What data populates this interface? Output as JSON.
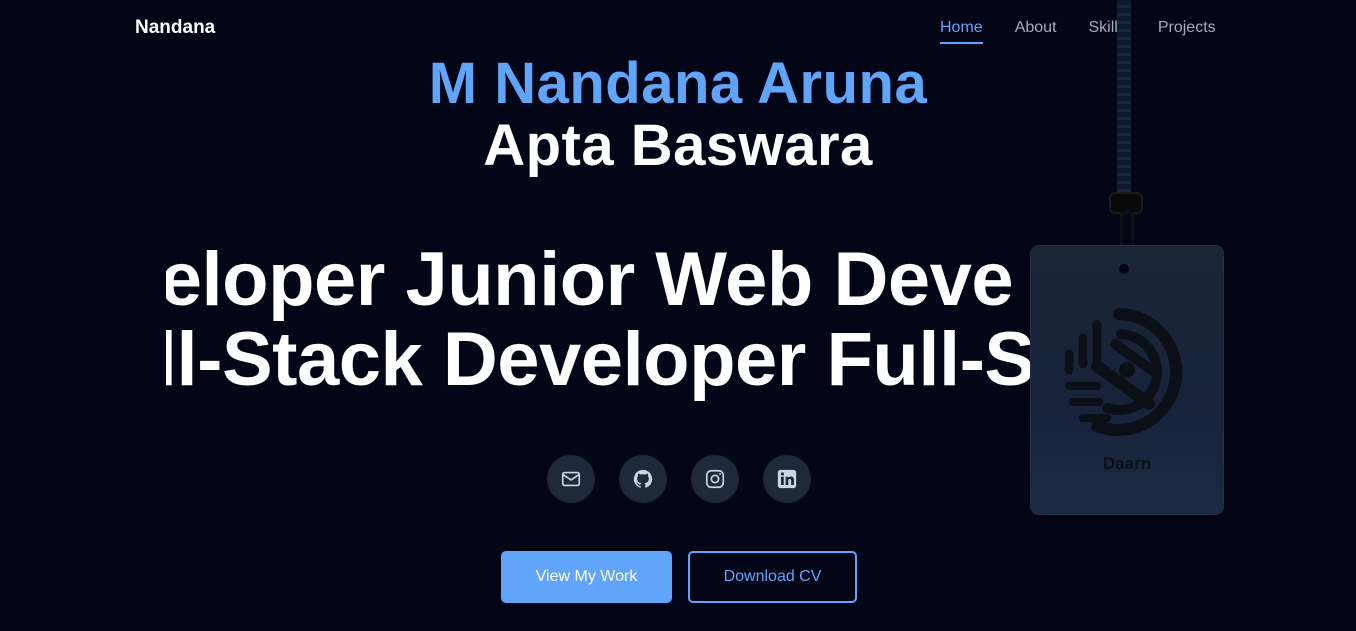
{
  "nav": {
    "brand": "Nandana",
    "items": [
      "Home",
      "About",
      "Skills",
      "Projects"
    ],
    "active": "Home"
  },
  "hero": {
    "name_first": "M Nandana Aruna",
    "name_last": "Apta Baswara",
    "marquee_row1": "veloper Junior Web Deve",
    "marquee_row2": "ull-Stack Developer Full-S"
  },
  "socials": [
    {
      "icon": "mail-icon"
    },
    {
      "icon": "github-icon"
    },
    {
      "icon": "instagram-icon"
    },
    {
      "icon": "linkedin-icon"
    }
  ],
  "buttons": {
    "primary": "View My Work",
    "secondary": "Download CV"
  },
  "badge": {
    "label": "Daarn",
    "icon": "monogram-logo"
  },
  "colors": {
    "background": "#030616",
    "accent": "#60a5fa",
    "text": "#ffffff",
    "muted": "#a3acbb",
    "social_bg": "#1e293b"
  }
}
